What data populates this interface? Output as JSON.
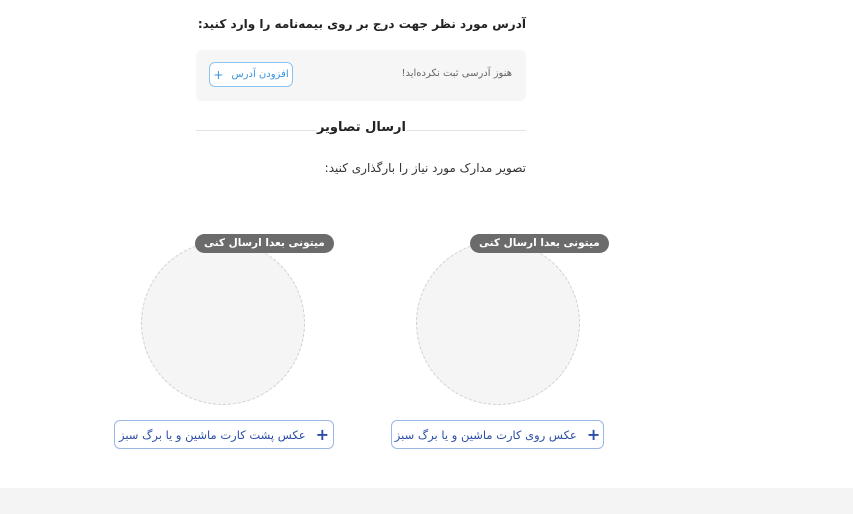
{
  "address": {
    "heading": "آدرس مورد نظر جهت درج بر روی بیمه‌نامه را وارد کنید:",
    "empty_text": "هنوز آدرسی ثبت نکرده‌اید!",
    "add_button_label": "افزودن آدرس",
    "add_button_icon": "plus-icon"
  },
  "images_section": {
    "title": "ارسال تصاویر",
    "instruction": "تصویر مدارک مورد نیاز را بارگذاری کنید:"
  },
  "uploads": [
    {
      "badge": "میتونی بعدا ارسال کنی",
      "button_label": "عکس روی کارت ماشین و یا برگ سبز",
      "button_icon": "plus-icon"
    },
    {
      "badge": "میتونی بعدا ارسال کنی",
      "button_label": "عکس پشت کارت ماشین و یا برگ سبز",
      "button_icon": "plus-icon"
    }
  ],
  "colors": {
    "accent_blue": "#3591dd",
    "upload_button_text": "#2c4ea8",
    "badge_bg": "#6b6b6b",
    "panel_bg": "#f6f6f7"
  }
}
